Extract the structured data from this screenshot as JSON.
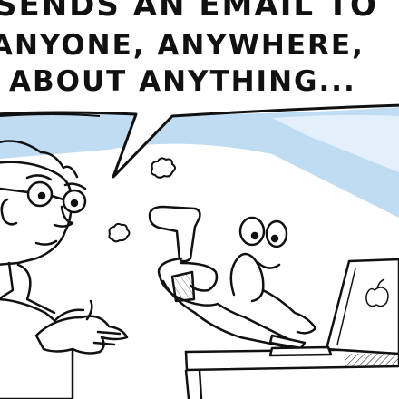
{
  "caption": {
    "line1": "SENDS AN EMAIL TO",
    "line2": "ANYONE, ANYWHERE,",
    "line3": "ABOUT ANYTHING..."
  },
  "colors": {
    "ink": "#111111",
    "sky": "#bfdcf3",
    "sky_light": "#e3f0fb",
    "paper": "#ffffff",
    "shade": "#cccccc"
  },
  "icons": {
    "laptop_logo": "apple-logo-icon"
  }
}
